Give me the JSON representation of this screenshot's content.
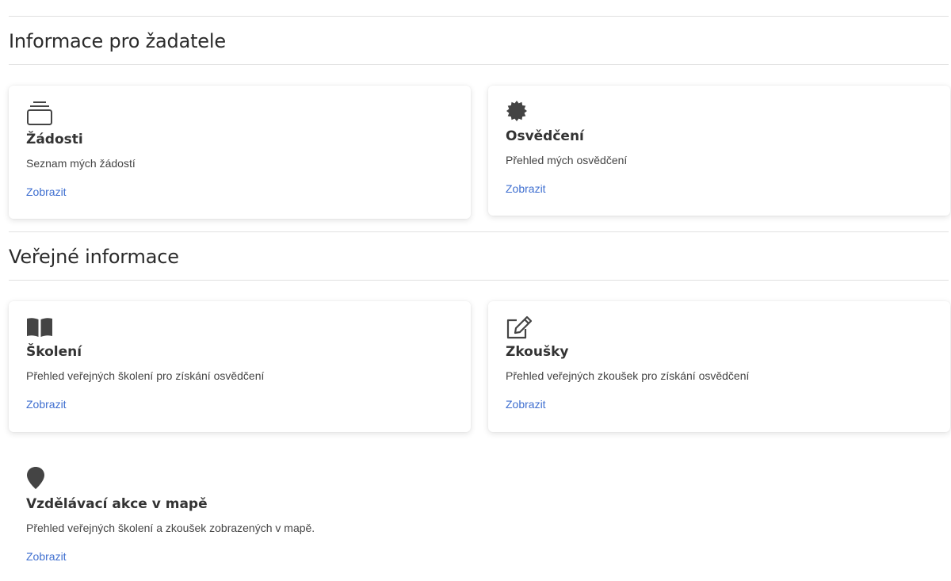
{
  "sections": {
    "applicant": {
      "title": "Informace pro žadatele"
    },
    "public": {
      "title": "Veřejné informace"
    }
  },
  "cards": {
    "requests": {
      "icon": "inbox-stack-icon",
      "title": "Žádosti",
      "description": "Seznam mých žádostí",
      "link": "Zobrazit"
    },
    "certificates": {
      "icon": "badge-seal-icon",
      "title": "Osvědčení",
      "description": "Přehled mých osvědčení",
      "link": "Zobrazit"
    },
    "trainings": {
      "icon": "open-book-icon",
      "title": "Školení",
      "description": "Přehled veřejných školení pro získání osvědčení",
      "link": "Zobrazit"
    },
    "exams": {
      "icon": "edit-pencil-icon",
      "title": "Zkoušky",
      "description": "Přehled veřejných zkoušek pro získání osvědčení",
      "link": "Zobrazit"
    },
    "map": {
      "icon": "map-pin-icon",
      "title": "Vzdělávací akce v mapě",
      "description": "Přehled veřejných školení a zkoušek zobrazených v mapě.",
      "link": "Zobrazit"
    }
  },
  "colors": {
    "link": "#3f6fd0",
    "icon": "#444444",
    "divider": "#e0e0e0"
  }
}
